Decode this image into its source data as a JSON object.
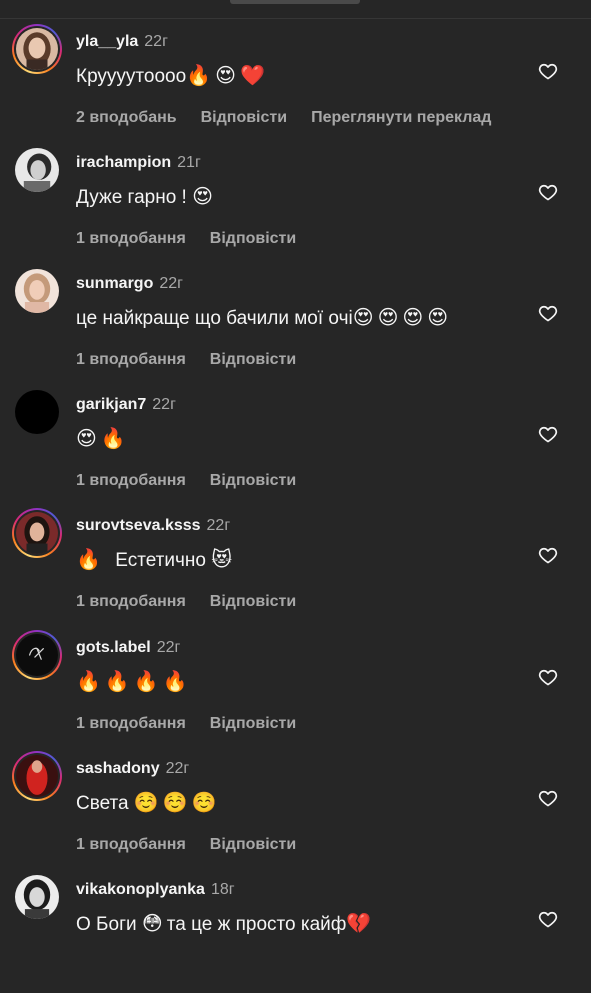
{
  "colors": {
    "background": "#262626",
    "text_primary": "#f5f5f5",
    "text_secondary": "#a8a8a8",
    "story_ring": [
      "#feda75",
      "#fa7e1e",
      "#d62976",
      "#962fbf",
      "#4f5bd5"
    ]
  },
  "icons": {
    "like": "heart-outline-icon"
  },
  "comments": [
    {
      "username": "yla__yla",
      "time": "22г",
      "text": "Круууутоооо",
      "emoji": "🔥😍❤️",
      "likes": "2 вподобань",
      "reply": "Відповісти",
      "translate": "Переглянути переклад"
    },
    {
      "username": "irachampion",
      "time": "21г",
      "text": "Дуже гарно ! ",
      "emoji": "😍",
      "likes": "1 вподобання",
      "reply": "Відповісти"
    },
    {
      "username": "sunmargo",
      "time": "22г",
      "text": "це найкраще що бачили мої очі",
      "emoji": "😍😍😍😍",
      "likes": "1 вподобання",
      "reply": "Відповісти"
    },
    {
      "username": "garikjan7",
      "time": "22г",
      "text": "",
      "emoji": "😍🔥",
      "likes": "1 вподобання",
      "reply": "Відповісти"
    },
    {
      "username": "surovtseva.ksss",
      "time": "22г",
      "text": "Естетично ",
      "emoji_before": "🔥 ",
      "emoji": "😻",
      "likes": "1 вподобання",
      "reply": "Відповісти"
    },
    {
      "username": "gots.label",
      "time": "22г",
      "text": "",
      "emoji": "🔥🔥🔥🔥",
      "likes": "1 вподобання",
      "reply": "Відповісти"
    },
    {
      "username": "sashadony",
      "time": "22г",
      "text": "Света ",
      "emoji": "☺️☺️☺️",
      "likes": "1 вподобання",
      "reply": "Відповісти"
    },
    {
      "username": "vikakonoplyanka",
      "time": "18г",
      "text_before": "О Боги ",
      "emoji_mid": "😳",
      "text": "та це ж просто кайф",
      "emoji": "💔"
    }
  ]
}
